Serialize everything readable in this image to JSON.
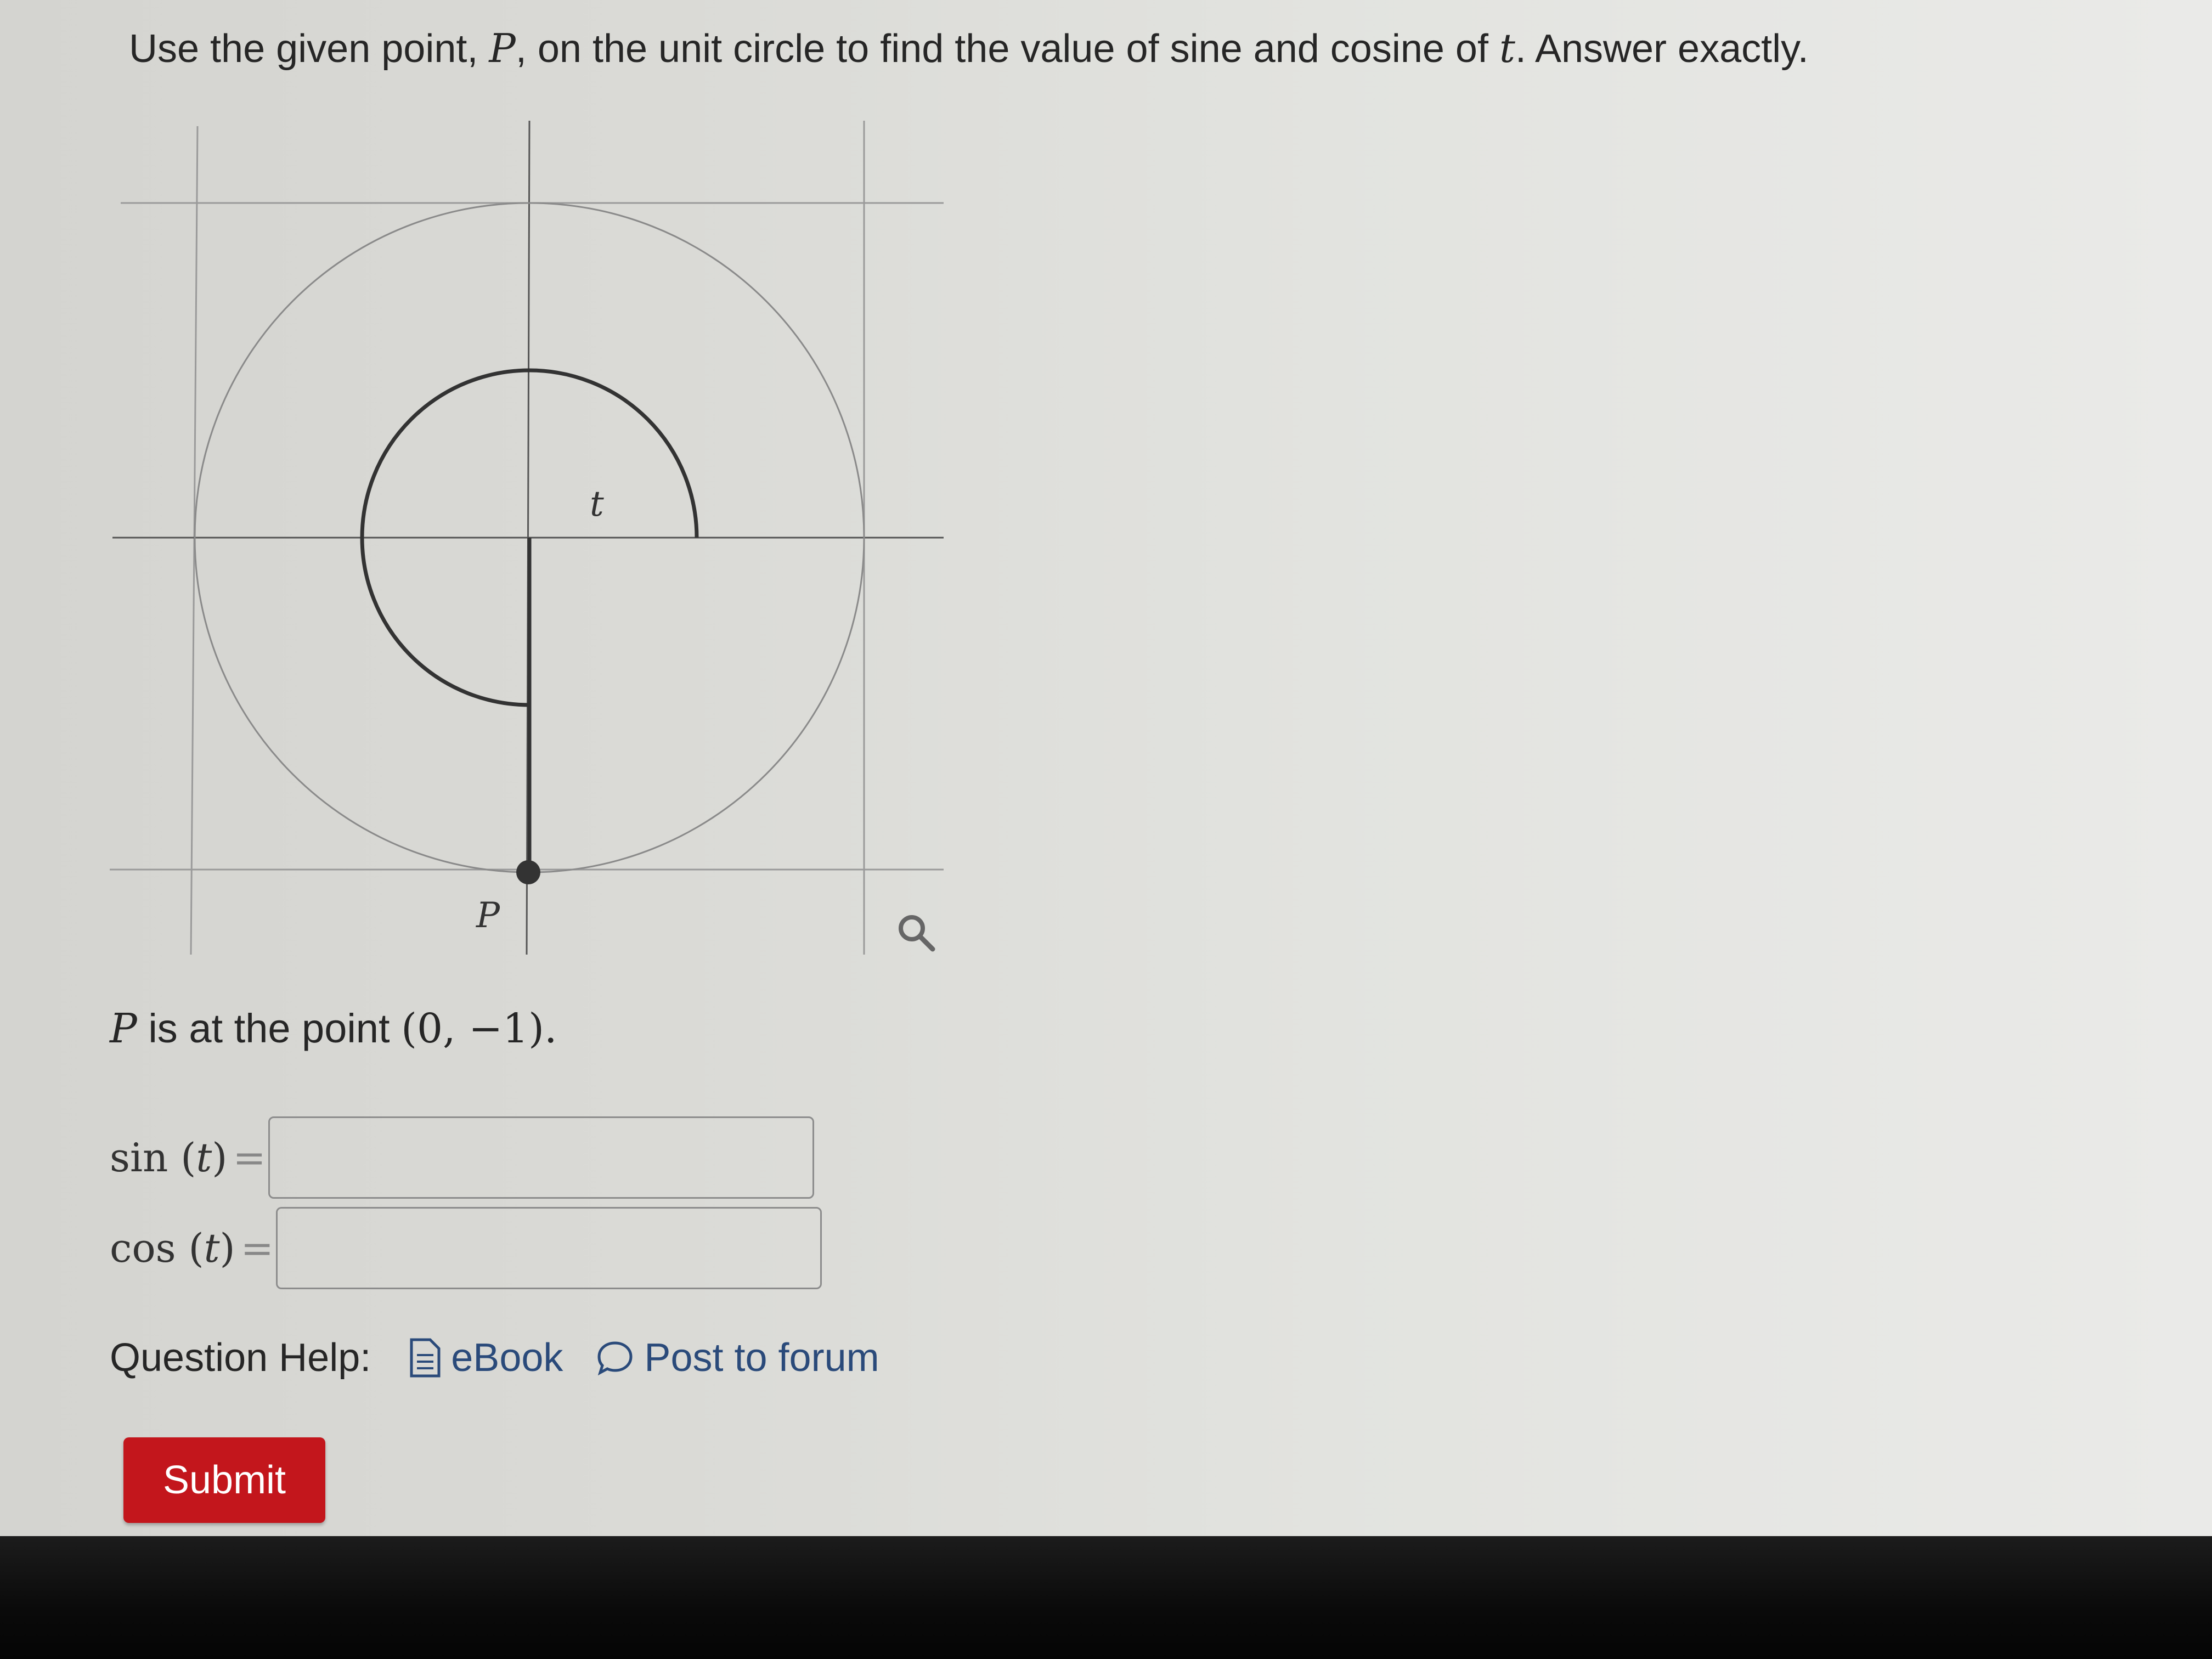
{
  "question": {
    "prefix": "Use the given point, ",
    "point_var": "P",
    "middle": ", on the unit circle to find the value of sine and cosine of ",
    "angle_var": "t",
    "suffix": ". Answer exactly."
  },
  "graph": {
    "angle_label": "t",
    "point_label": "P",
    "zoom_icon": "magnifier-icon"
  },
  "point_statement": {
    "var": "P",
    "text": " is at the point ",
    "coords": "(0, −1)."
  },
  "answers": {
    "sin_fn": "sin (",
    "sin_var": "t",
    "sin_close": ")",
    "cos_fn": "cos (",
    "cos_var": "t",
    "cos_close": ")",
    "equals": "=",
    "sin_value": "",
    "cos_value": ""
  },
  "help": {
    "label": "Question Help:",
    "ebook": "eBook",
    "ebook_icon": "document-icon",
    "forum": "Post to forum",
    "forum_icon": "speech-bubble-icon"
  },
  "submit_label": "Submit",
  "colors": {
    "submit": "#c3161c",
    "link": "#2a4a7a",
    "arc": "#333333"
  }
}
